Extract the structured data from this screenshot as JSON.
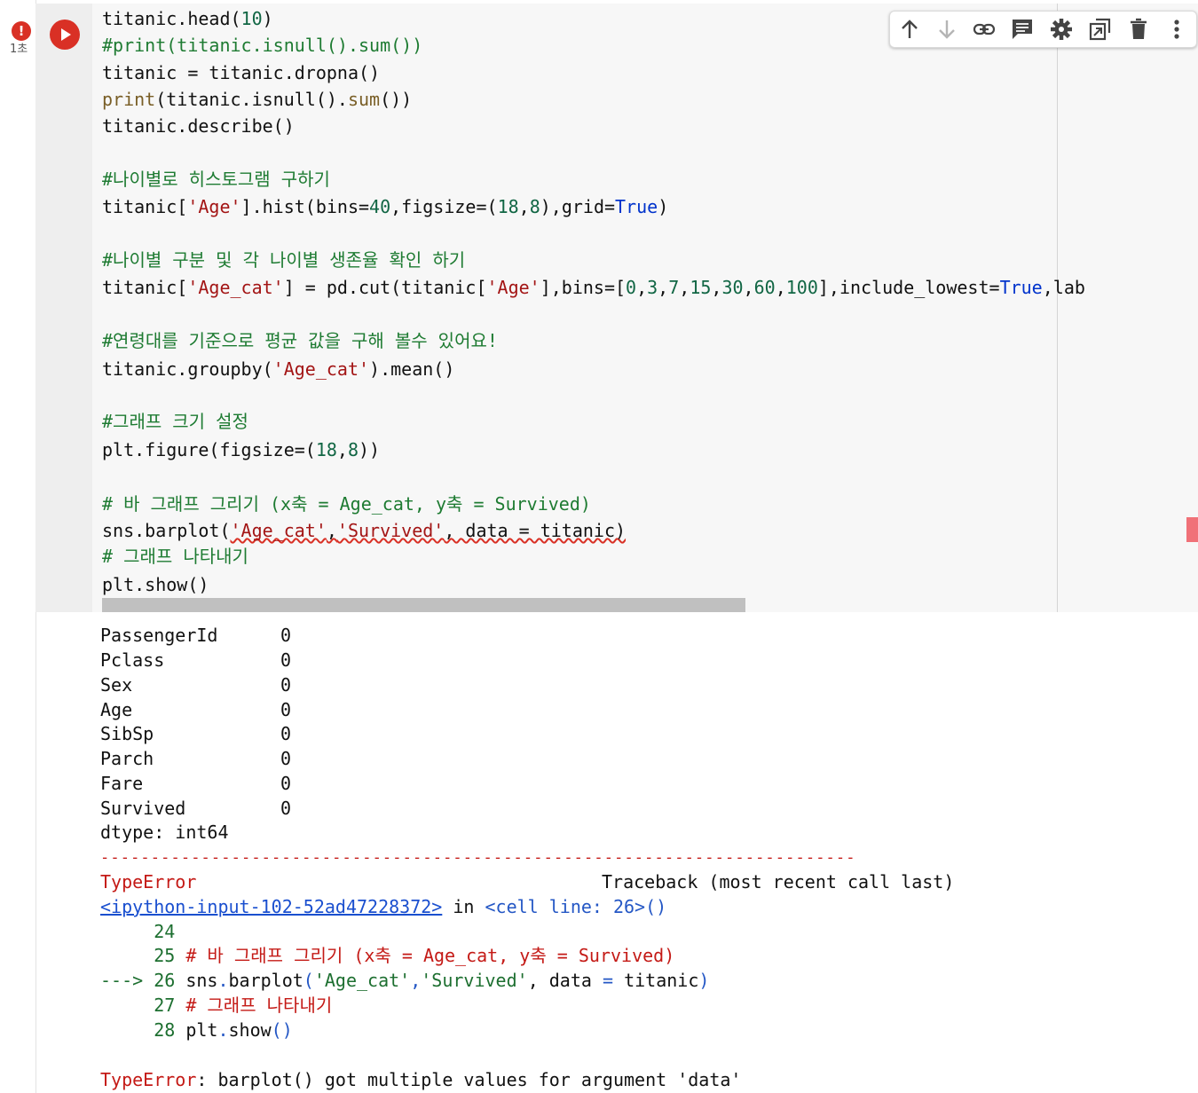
{
  "gutter": {
    "status_symbol": "!",
    "exec_time": "1초"
  },
  "toolbar": {
    "icons": [
      "arrow-up-icon",
      "arrow-down-icon",
      "link-icon",
      "comment-icon",
      "gear-icon",
      "mirror-cell-icon",
      "trash-icon",
      "more-vert-icon"
    ]
  },
  "code": {
    "l1": "titanic.head(",
    "l1n": "10",
    "l1e": ")",
    "l2": "#print(titanic.isnull().sum())",
    "l3": "titanic = titanic.dropna()",
    "l4a": "print",
    "l4b": "(titanic.isnull().",
    "l4c": "sum",
    "l4d": "())",
    "l5": "titanic.describe()",
    "l6": "#나이별로 히스토그램 구하기",
    "l7a": "titanic[",
    "l7b": "'Age'",
    "l7c": "].hist(bins=",
    "l7d": "40",
    "l7e": ",figsize=(",
    "l7f": "18",
    "l7g": ",",
    "l7h": "8",
    "l7i": "),grid=",
    "l7j": "True",
    "l7k": ")",
    "l8": "#나이별 구분 및 각 나이별 생존율 확인 하기",
    "l9a": "titanic[",
    "l9b": "'Age_cat'",
    "l9c": "] = pd.cut(titanic[",
    "l9d": "'Age'",
    "l9e": "],bins=[",
    "l9n1": "0",
    "l9n2": "3",
    "l9n3": "7",
    "l9n4": "15",
    "l9n5": "30",
    "l9n6": "60",
    "l9n7": "100",
    "l9f": "],include_lowest=",
    "l9g": "True",
    "l9h": ",lab",
    "l10": "#연령대를 기준으로 평균 값을 구해 볼수 있어요!",
    "l11a": "titanic.groupby(",
    "l11b": "'Age_cat'",
    "l11c": ").mean()",
    "l12": "#그래프 크기 설정",
    "l13a": "plt.figure(figsize=(",
    "l13b": "18",
    "l13c": ",",
    "l13d": "8",
    "l13e": "))",
    "l14": "# 바 그래프 그리기 (x축 = Age_cat, y축 = Survived)",
    "l15a": "sns.barplot(",
    "l15b": "'Age_cat'",
    "l15c": ",",
    "l15d": "'Survived'",
    "l15e": ", data = titanic)",
    "l16": "# 그래프 나타내기",
    "l17": "plt.show()"
  },
  "output": {
    "rows": [
      {
        "name": "PassengerId",
        "value": "0"
      },
      {
        "name": "Pclass",
        "value": "0"
      },
      {
        "name": "Sex",
        "value": "0"
      },
      {
        "name": "Age",
        "value": "0"
      },
      {
        "name": "SibSp",
        "value": "0"
      },
      {
        "name": "Parch",
        "value": "0"
      },
      {
        "name": "Fare",
        "value": "0"
      },
      {
        "name": "Survived",
        "value": "0"
      }
    ],
    "dtype": "dtype: int64",
    "separator": "---------------------------------------------------------------------------",
    "err_type": "TypeError",
    "traceback_header": "Traceback (most recent call last)",
    "input_link": "<ipython-input-102-52ad47228372>",
    "in_word": " in ",
    "cell_ref": "<cell line: 26>",
    "cell_parens": "()",
    "tb24": "     24",
    "tb25a": "     25 ",
    "tb25b": "# 바 그래프 그리기 (x축 = Age_cat, y축 = Survived)",
    "tb26a": "---> 26 ",
    "tb26b": "sns",
    "tb26c": ".",
    "tb26d": "barplot",
    "tb26e": "(",
    "tb26f": "'Age_cat'",
    "tb26g": ",",
    "tb26h": "'Survived'",
    "tb26i": ", data ",
    "tb26j": "=",
    "tb26k": " titanic",
    "tb26l": ")",
    "tb27a": "     27 ",
    "tb27b": "# 그래프 나타내기",
    "tb28a": "     28 ",
    "tb28b": "plt",
    "tb28c": ".",
    "tb28d": "show",
    "tb28e": "()",
    "final_err_type": "TypeError",
    "final_err_msg": ": barplot() got multiple values for argument 'data'"
  }
}
